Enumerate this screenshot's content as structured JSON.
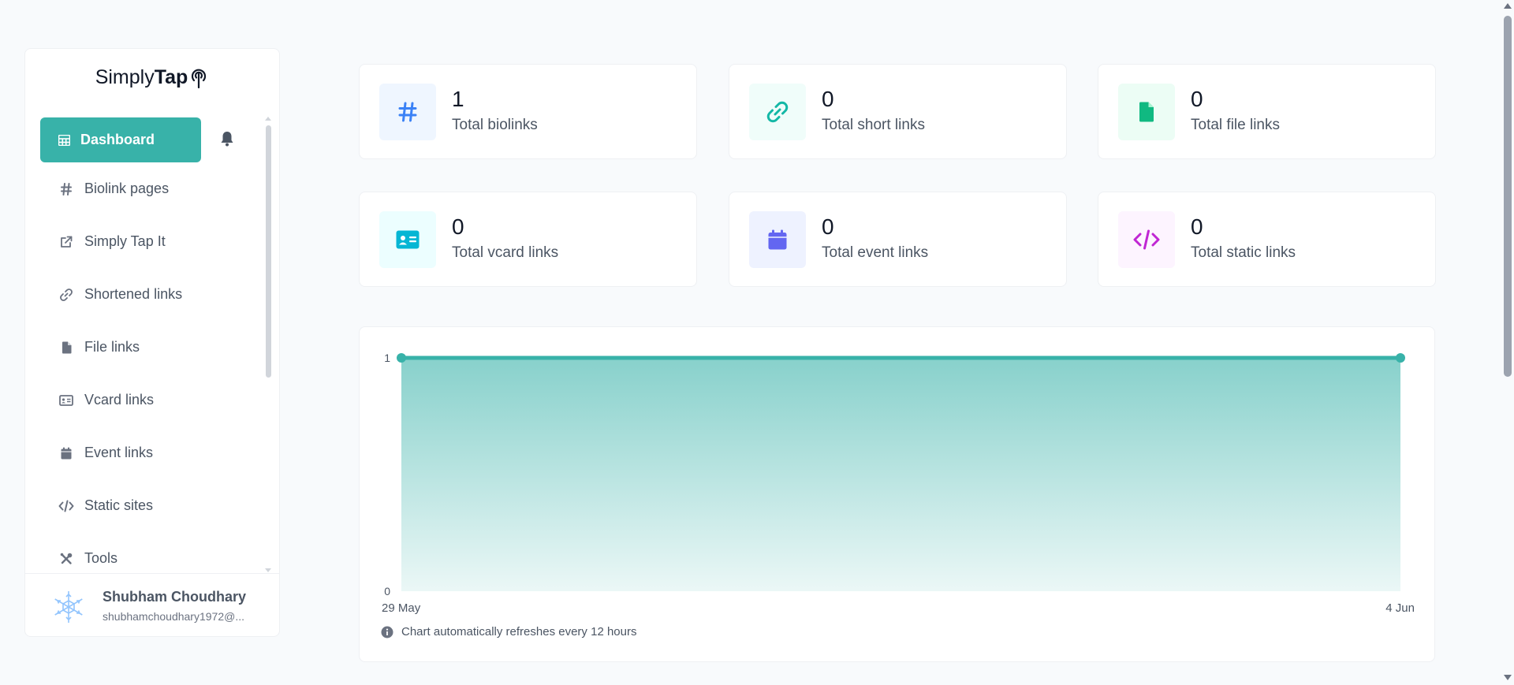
{
  "brand": {
    "light": "Simply",
    "bold": "Tap"
  },
  "nav": {
    "active_label": "Dashboard",
    "items": [
      {
        "label": "Biolink pages",
        "icon": "hash-icon"
      },
      {
        "label": "Simply Tap It",
        "icon": "external-link-icon"
      },
      {
        "label": "Shortened links",
        "icon": "link-icon"
      },
      {
        "label": "File links",
        "icon": "file-icon"
      },
      {
        "label": "Vcard links",
        "icon": "id-card-icon"
      },
      {
        "label": "Event links",
        "icon": "calendar-icon"
      },
      {
        "label": "Static sites",
        "icon": "code-icon"
      },
      {
        "label": "Tools",
        "icon": "tools-icon"
      }
    ]
  },
  "user": {
    "name": "Shubham Choudhary",
    "email": "shubhamchoudhary1972@..."
  },
  "stats": [
    {
      "value": "1",
      "label": "Total biolinks",
      "icon": "hash-icon",
      "color": "#3b82f6",
      "bg": "#eff6ff"
    },
    {
      "value": "0",
      "label": "Total short links",
      "icon": "link-icon",
      "color": "#14b8a6",
      "bg": "#f0fdfa"
    },
    {
      "value": "0",
      "label": "Total file links",
      "icon": "file-icon",
      "color": "#10b981",
      "bg": "#ecfdf5"
    },
    {
      "value": "0",
      "label": "Total vcard links",
      "icon": "id-card-icon",
      "color": "#06b6d4",
      "bg": "#ecfeff"
    },
    {
      "value": "0",
      "label": "Total event links",
      "icon": "calendar-icon",
      "color": "#6366f1",
      "bg": "#eef2ff"
    },
    {
      "value": "0",
      "label": "Total static links",
      "icon": "code-icon",
      "color": "#c026d3",
      "bg": "#fdf4ff"
    }
  ],
  "chart_data": {
    "type": "area",
    "x": [
      "29 May",
      "4 Jun"
    ],
    "values": [
      1,
      1
    ],
    "ylim": [
      0,
      1
    ],
    "yticks": [
      "1",
      "0"
    ],
    "grid": false,
    "color": "#38b2a9"
  },
  "chart_note": "Chart automatically refreshes every 12 hours"
}
